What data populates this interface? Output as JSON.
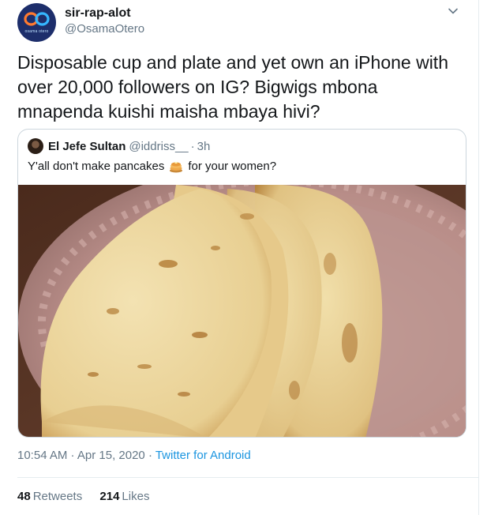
{
  "author": {
    "display_name": "sir-rap-alot",
    "handle": "@OsamaOtero",
    "avatar_brand_text": "osama otero"
  },
  "tweet": {
    "text": "Disposable cup and plate and yet own an iPhone with over 20,000 followers on IG? Bigwigs mbona mnapenda kuishi maisha mbaya hivi?"
  },
  "quoted_tweet": {
    "display_name": "El Jefe Sultan",
    "handle": "@iddriss__",
    "separator": "·",
    "time": "3h",
    "text_before_emoji": "Y'all don't make pancakes",
    "emoji": "pancakes-emoji",
    "text_after_emoji": "for your women?",
    "image": "photo-of-pancakes-on-disposable-plate"
  },
  "meta": {
    "time_date": "10:54 AM · Apr 15, 2020 · ",
    "source": "Twitter for Android"
  },
  "stats": {
    "retweets_count": "48",
    "retweets_label": "Retweets",
    "likes_count": "214",
    "likes_label": "Likes"
  },
  "icons": {
    "caret": "chevron-down-icon"
  },
  "colors": {
    "link": "#1b95e0",
    "secondary_text": "#657786",
    "primary_text": "#14171a",
    "border": "#ccd6dd"
  }
}
